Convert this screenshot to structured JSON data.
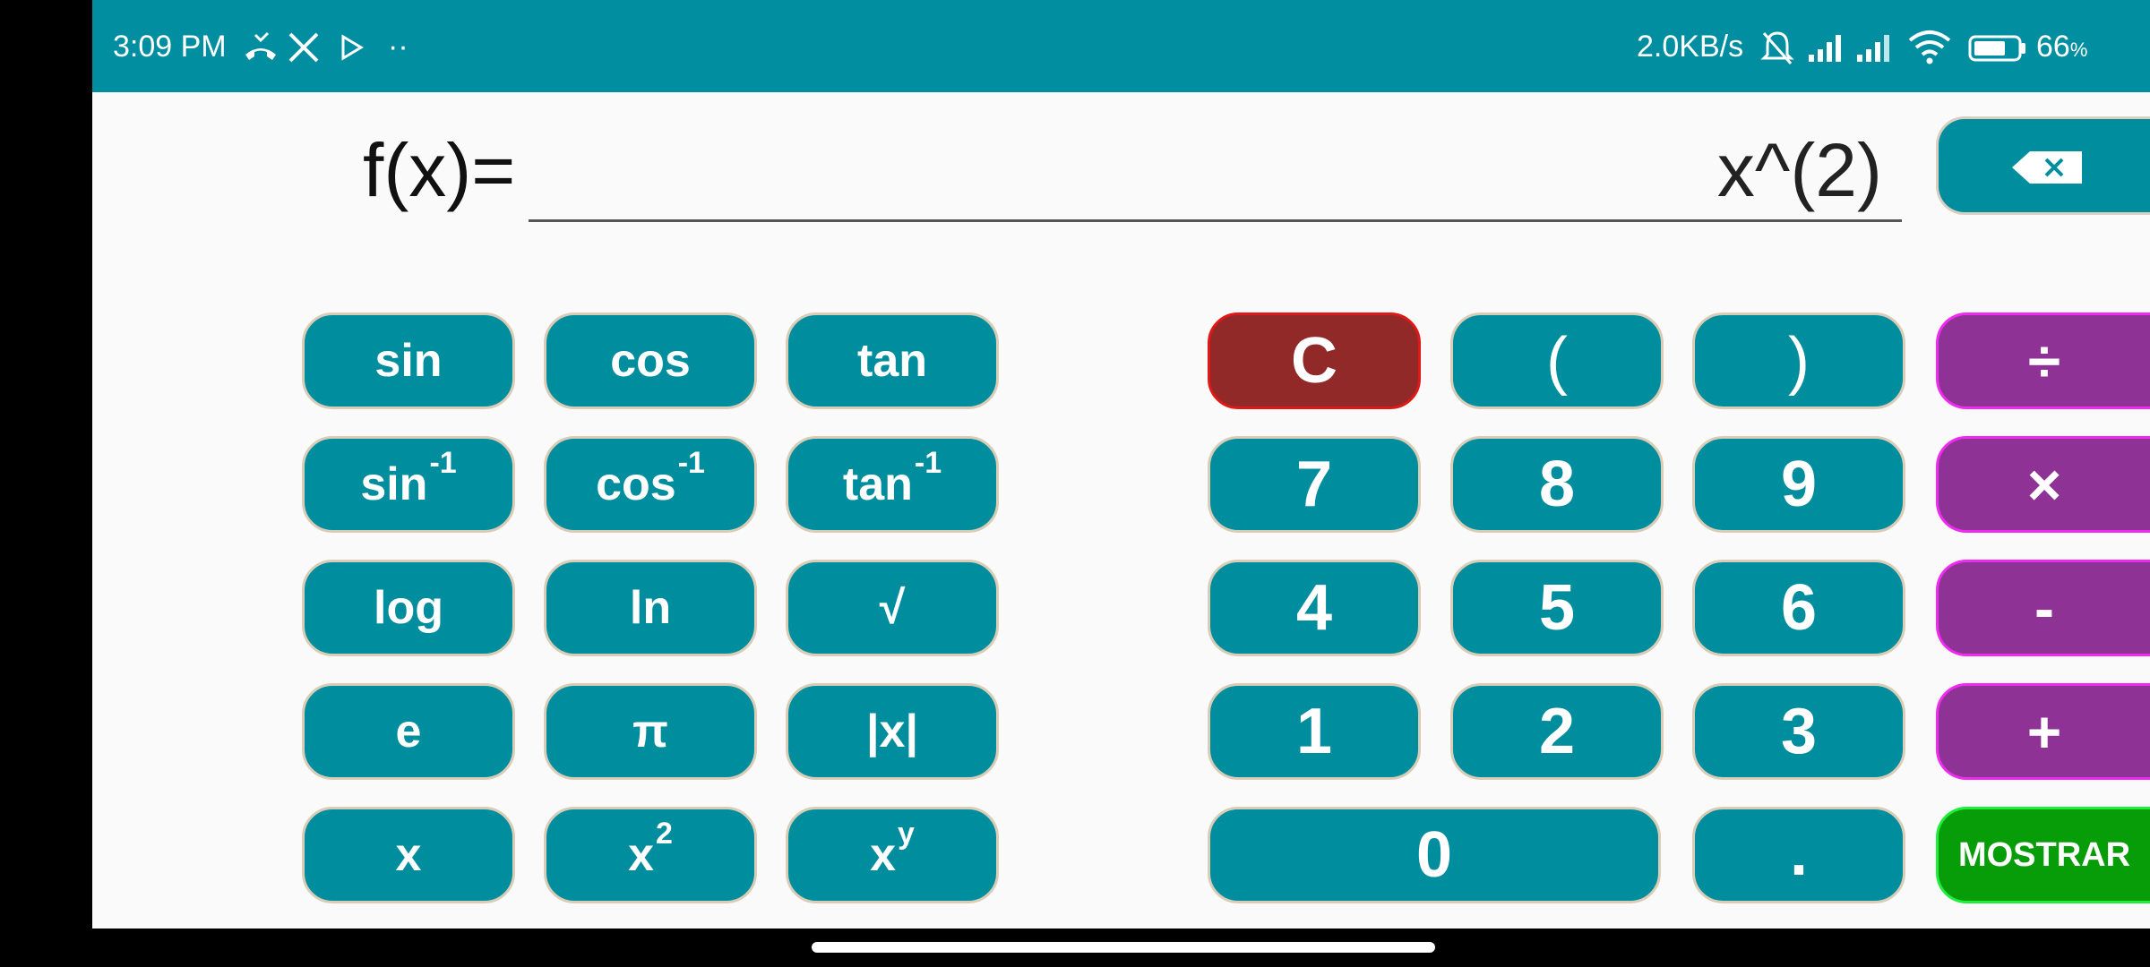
{
  "status_bar": {
    "time": "3:09 PM",
    "network_speed": "2.0KB/s",
    "battery_percent": "66",
    "battery_unit": "%",
    "overflow_dots": "··",
    "left_icons": [
      "missed-call-icon",
      "x-app-icon",
      "play-store-icon",
      "more-notifications-icon"
    ],
    "right_icons": [
      "mute-bell-icon",
      "signal-sim1-icon",
      "signal-sim2-icon",
      "wifi-icon",
      "battery-icon"
    ],
    "color": "#008ea0"
  },
  "expression": {
    "label": "f(x)=",
    "value": "x^(2)"
  },
  "backspace_icon": "backspace-icon",
  "function_keys": {
    "sin": "sin",
    "cos": "cos",
    "tan": "tan",
    "asin": "sin",
    "acos": "cos",
    "atan": "tan",
    "inverse_exp": "-1",
    "log": "log",
    "ln": "ln",
    "sqrt": "√",
    "e": "e",
    "pi": "π",
    "abs": "|x|",
    "x": "x",
    "x_base": "x",
    "square_exp": "2",
    "pow_exp": "y"
  },
  "number_keys": {
    "clear": "C",
    "lparen": "(",
    "rparen": ")",
    "seven": "7",
    "eight": "8",
    "nine": "9",
    "four": "4",
    "five": "5",
    "six": "6",
    "one": "1",
    "two": "2",
    "three": "3",
    "zero": "0",
    "dot": "."
  },
  "operator_keys": {
    "divide": "÷",
    "multiply": "×",
    "minus": "-",
    "plus": "+"
  },
  "show_button": "MOSTRAR",
  "colors": {
    "key": "#008e9e",
    "clear": "#912929",
    "operator": "#8e3296",
    "show": "#079d09",
    "background": "#fafafa"
  }
}
